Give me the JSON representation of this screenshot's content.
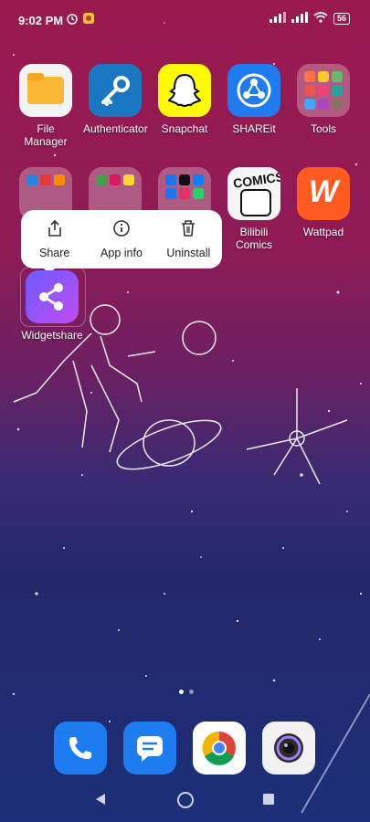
{
  "status": {
    "time": "9:02 PM",
    "battery": "56"
  },
  "apps_row1": [
    {
      "name": "File Manager",
      "icon": "folder-icon"
    },
    {
      "name": "Authenticator",
      "icon": "key-icon"
    },
    {
      "name": "Snapchat",
      "icon": "ghost-icon"
    },
    {
      "name": "SHAREit",
      "icon": "share-nodes-icon"
    },
    {
      "name": "Tools",
      "icon": "tools-folder-icon"
    }
  ],
  "apps_row2": [
    {
      "name": "Bilibili Comics",
      "icon": "comics-icon"
    },
    {
      "name": "Wattpad",
      "icon": "w-icon"
    }
  ],
  "context_menu": {
    "share": "Share",
    "app_info": "App info",
    "uninstall": "Uninstall"
  },
  "widget_app": {
    "name": "Widgetshare"
  },
  "dock": [
    {
      "name": "Phone",
      "icon": "phone-icon"
    },
    {
      "name": "Messages",
      "icon": "message-icon"
    },
    {
      "name": "Chrome",
      "icon": "chrome-icon"
    },
    {
      "name": "Camera",
      "icon": "camera-icon"
    }
  ],
  "colors": {
    "wattpad": "#ff5a1f",
    "snapchat": "#fffc00",
    "shareit": "#1e7bf0",
    "authenticator": "#1a78c2"
  }
}
